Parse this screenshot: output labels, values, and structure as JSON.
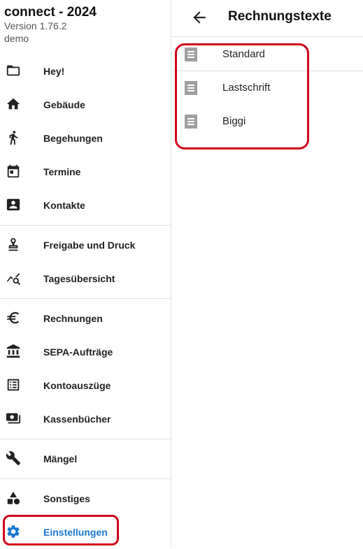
{
  "app": {
    "title": "connect - 2024",
    "version": "Version 1.76.2",
    "user": "demo"
  },
  "colors": {
    "accent": "#1976d2",
    "highlight": "#d0021b",
    "icon_gray": "#9e9e9e"
  },
  "sidebar": {
    "groups": [
      [
        {
          "label": "Hey!",
          "icon": "folder-icon"
        },
        {
          "label": "Gebäude",
          "icon": "home-icon"
        },
        {
          "label": "Begehungen",
          "icon": "walk-icon"
        },
        {
          "label": "Termine",
          "icon": "calendar-icon"
        },
        {
          "label": "Kontakte",
          "icon": "contacts-icon"
        }
      ],
      [
        {
          "label": "Freigabe und Druck",
          "icon": "stamp-icon"
        },
        {
          "label": "Tagesübersicht",
          "icon": "query-stats-icon"
        }
      ],
      [
        {
          "label": "Rechnungen",
          "icon": "euro-icon"
        },
        {
          "label": "SEPA-Aufträge",
          "icon": "bank-icon"
        },
        {
          "label": "Kontoauszüge",
          "icon": "list-alt-icon"
        },
        {
          "label": "Kassenbücher",
          "icon": "money-icon"
        }
      ],
      [
        {
          "label": "Mängel",
          "icon": "wrench-icon"
        }
      ],
      [
        {
          "label": "Sonstiges",
          "icon": "category-icon"
        },
        {
          "label": "Einstellungen",
          "icon": "gear-icon",
          "active": true
        }
      ]
    ]
  },
  "panel": {
    "title": "Rechnungstexte",
    "back_icon": "arrow-back-icon",
    "items": [
      {
        "label": "Standard",
        "icon": "document-icon"
      },
      {
        "label": "Lastschrift",
        "icon": "document-icon"
      },
      {
        "label": "Biggi",
        "icon": "document-icon"
      }
    ]
  }
}
